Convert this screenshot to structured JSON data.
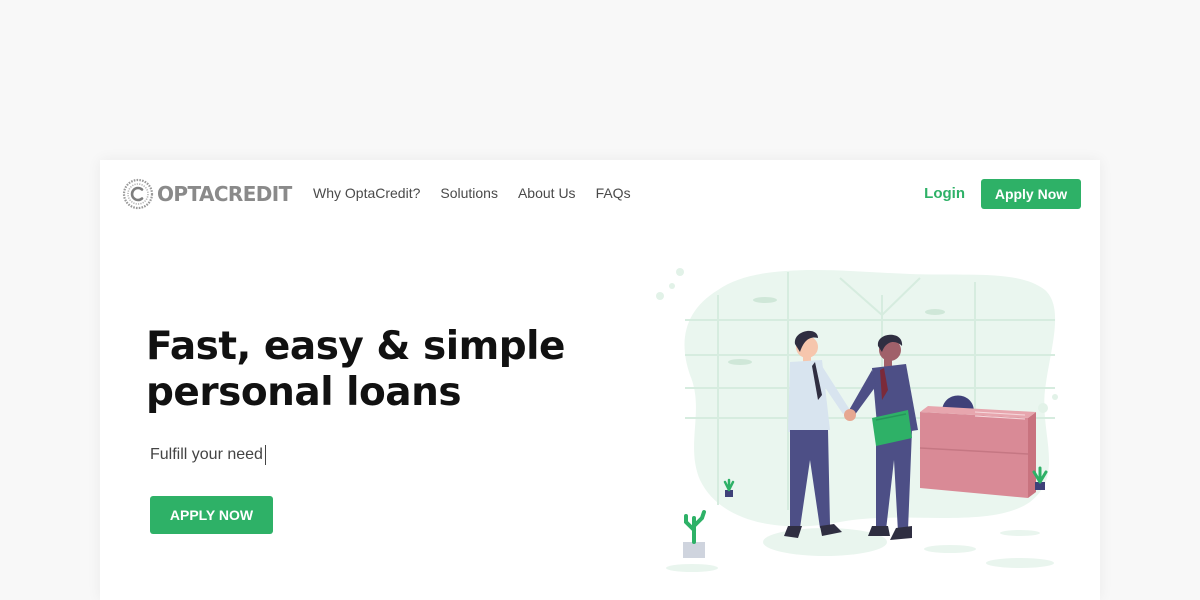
{
  "brand": {
    "name": "OPTACREDIT"
  },
  "nav": {
    "links": [
      "Why OptaCredit?",
      "Solutions",
      "About Us",
      "FAQs"
    ],
    "login_label": "Login",
    "apply_label": "Apply Now"
  },
  "hero": {
    "headline_line1": "Fast, easy & simple",
    "headline_line2": "personal loans",
    "subtitle": "Fulfill your need",
    "cta_label": "APPLY NOW"
  },
  "colors": {
    "accent": "#2eb167",
    "background": "#f8f8f8",
    "card": "#ffffff",
    "illustration_blob": "#eaf6ef",
    "desk": "#d98a96",
    "suit": "#4d4f86"
  },
  "icons": {
    "logo": "optacredit-logo-icon",
    "illustration": "business-handshake-illustration"
  }
}
